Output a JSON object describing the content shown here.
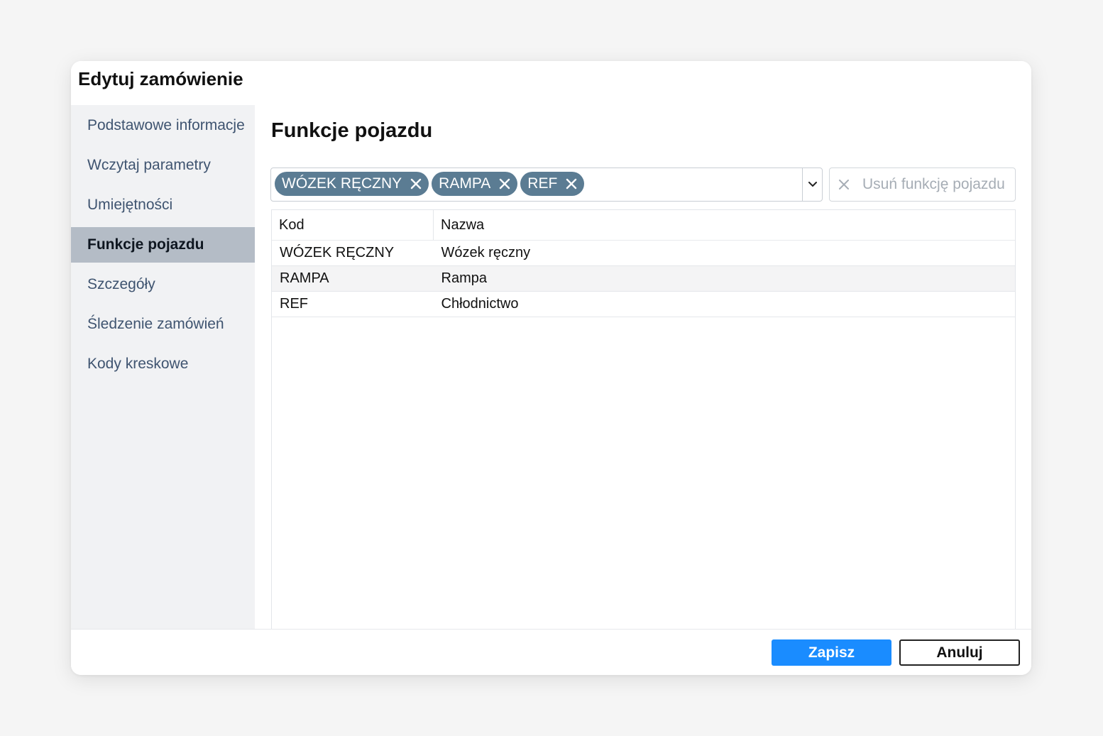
{
  "modal": {
    "title": "Edytuj zamówienie"
  },
  "sidebar": {
    "items": [
      {
        "label": "Podstawowe informacje",
        "active": false
      },
      {
        "label": "Wczytaj parametry",
        "active": false
      },
      {
        "label": "Umiejętności",
        "active": false
      },
      {
        "label": "Funkcje pojazdu",
        "active": true
      },
      {
        "label": "Szczegóły",
        "active": false
      },
      {
        "label": "Śledzenie zamówień",
        "active": false
      },
      {
        "label": "Kody kreskowe",
        "active": false
      }
    ]
  },
  "main": {
    "section_title": "Funkcje pojazdu",
    "selected_tags": [
      {
        "label": "WÓZEK RĘCZNY"
      },
      {
        "label": "RAMPA"
      },
      {
        "label": "REF"
      }
    ],
    "remove_button_label": "Usuń funkcję pojazdu",
    "table": {
      "headers": {
        "kod": "Kod",
        "nazwa": "Nazwa"
      },
      "rows": [
        {
          "kod": "WÓZEK RĘCZNY",
          "nazwa": "Wózek ręczny"
        },
        {
          "kod": "RAMPA",
          "nazwa": "Rampa"
        },
        {
          "kod": "REF",
          "nazwa": "Chłodnictwo"
        }
      ]
    }
  },
  "footer": {
    "save_label": "Zapisz",
    "cancel_label": "Anuluj"
  },
  "colors": {
    "primary": "#1a8cff",
    "tag_background": "#5b7c93",
    "active_nav_background": "#b4bcc6",
    "sidebar_background": "#f1f2f4"
  },
  "icons": {
    "tag_remove": "close-icon",
    "dropdown": "chevron-down-icon",
    "remove_feature": "close-icon"
  }
}
